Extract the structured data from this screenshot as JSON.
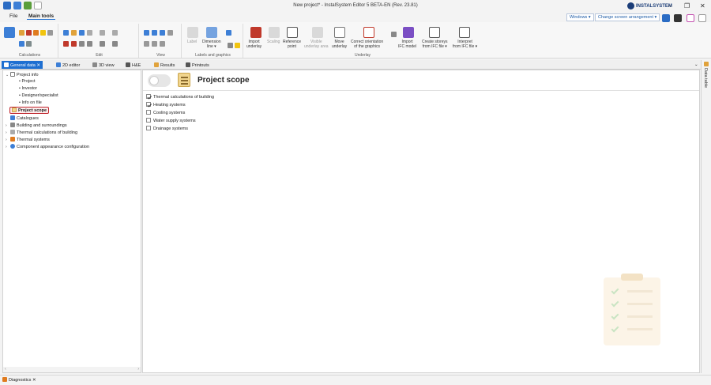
{
  "window": {
    "title": "New project* - InstalSystem Editor 5 BETA-EN (Rev. 23.81)",
    "brand": "INSTALSYSTEM",
    "minimize": "–",
    "maximize": "❐",
    "close": "✕"
  },
  "menu": {
    "file": "File",
    "main_tools": "Main tools",
    "windows": "Windows ▾",
    "change_arrangement": "Change screen arrangement ▾"
  },
  "ribbon": {
    "groups": {
      "calculations": "Calculations",
      "edit": "Edit",
      "view": "View",
      "labels": "Labels and graphics",
      "underlay": "Underlay"
    },
    "label": "Label",
    "dimension": "Dimension\nline ▾",
    "import_underlay": "Import\nunderlay",
    "scaling": "Scaling",
    "reference_point": "Reference\npoint",
    "visible_underlay": "Visible\nunderlay area",
    "move_underlay": "Move\nunderlay",
    "correct_orientation": "Correct orientation\nof the graphics",
    "import_ifc": "Import\nIFC model",
    "create_storeys": "Create storeys\nfrom IFC file ▾",
    "interpret": "Interpret\nfrom IFC file ▾"
  },
  "tabs": [
    {
      "label": "General data",
      "active": true
    },
    {
      "label": "2D editor"
    },
    {
      "label": "3D view"
    },
    {
      "label": "H&E"
    },
    {
      "label": "Results"
    },
    {
      "label": "Printouts"
    }
  ],
  "tree": {
    "project_info": "Project info",
    "project": "Project",
    "investor": "Investor",
    "designer": "Designer/specialist",
    "info_on_file": "Info on file",
    "project_scope": "Project scope",
    "catalogues": "Catalogues",
    "building": "Building and surroundings",
    "thermal_calc": "Thermal calculations of building",
    "thermal_systems": "Thermal systems",
    "component_config": "Component appearance configuration"
  },
  "main": {
    "title": "Project scope",
    "options": [
      {
        "label": "Thermal calculations of building",
        "checked": true
      },
      {
        "label": "Heating systems",
        "checked": true
      },
      {
        "label": "Cooling systems",
        "checked": false
      },
      {
        "label": "Water supply systems",
        "checked": false
      },
      {
        "label": "Drainage systems",
        "checked": false
      }
    ]
  },
  "right_panel": {
    "label": "Data table"
  },
  "status": {
    "diagnostics": "Diagnostics"
  },
  "colors": {
    "accent": "#1e6fd1",
    "highlight_border": "#c0262d"
  }
}
